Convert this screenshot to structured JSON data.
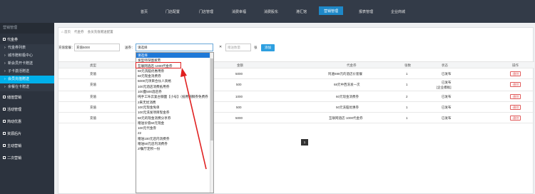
{
  "topnav": {
    "items": [
      "首页",
      "门店配置",
      "门店管理",
      "消费幸福",
      "消费股东",
      "港汇馆",
      "营销管理",
      "报表管理",
      "企业商城"
    ],
    "active_index": 6
  },
  "sidebar": {
    "header": "营销管理",
    "group1": "代金券",
    "subs": [
      "代金券列表",
      "城市赠积极中心",
      "新会员开卡赠送",
      "子卡激活赠送",
      "会员充值赠送",
      "余餐在卡赠送"
    ],
    "active_sub": 4,
    "groups": [
      "储值营销",
      "活动管理",
      "简动优惠",
      "资源后片",
      "主动营销",
      "二次营销"
    ]
  },
  "breadcrumb": {
    "home": "首页",
    "level1": "代金券",
    "level2": "会员充值赠送配置"
  },
  "search": {
    "recharge_label": "充值套餐：",
    "recharge_value": "充值5000",
    "select_label": "送券：",
    "select_value": "请选择",
    "qty_placeholder": "赠送数量",
    "unit": "张",
    "add_label": "添加"
  },
  "table": {
    "headers": [
      "类型",
      "",
      "金额",
      "代金券",
      "张数",
      "状态",
      "操作"
    ],
    "rows": [
      {
        "type": "充值",
        "amount": "5000",
        "coupon": "阿遍698元的酒店价套餐",
        "count": "1",
        "status": "已发布",
        "status2": "",
        "op": "删除"
      },
      {
        "type": "充值",
        "amount": "500",
        "coupon": "68元中西洗发一次",
        "count": "1",
        "status": "已发布",
        "status2": "[企业模板]",
        "op": "删除"
      },
      {
        "type": "充值",
        "amount": "1000",
        "coupon": "60元现金消费券",
        "count": "2",
        "status": "已发布",
        "status2": "",
        "op": "删除"
      },
      {
        "type": "充值",
        "amount": "500",
        "coupon": "50元洗脑优惠券",
        "count": "1",
        "status": "已发布",
        "status2": "",
        "op": "删除"
      },
      {
        "type": "充值",
        "amount": "5000",
        "coupon": "互联网酒店·1000代金券",
        "count": "1",
        "status": "已发布",
        "status2": "",
        "op": "删除"
      }
    ]
  },
  "pager": {
    "current": "1"
  },
  "dropdown": {
    "options": [
      "请选择",
      "发型师深图发劳",
      "互联网酒店·1000代金券",
      "50元洗脑优惠用券",
      "60元现金消费券",
      "5000元项目合伙人资格",
      "100元酒店消费抵用券",
      "100面500酒店券",
      "纯手工咔云复古钢面【小号】（抵用纯钢券免费券（100元以内）",
      "2来无忧消费",
      "100元现金免单",
      "100元洗发项目现金券",
      "50元的现金消费分享券",
      "赠送价值50元现金",
      "100元代金券",
      "22",
      "赠送100元店内消费券",
      "赠送50元店内消费券",
      "2f餐厅定积一份"
    ],
    "highlight_index": 0,
    "boxed_index": 2
  },
  "colors": {
    "accent": "#1e88c8",
    "danger": "#e05a5a",
    "sidebar": "#2c333e",
    "topbar": "#333b48"
  }
}
